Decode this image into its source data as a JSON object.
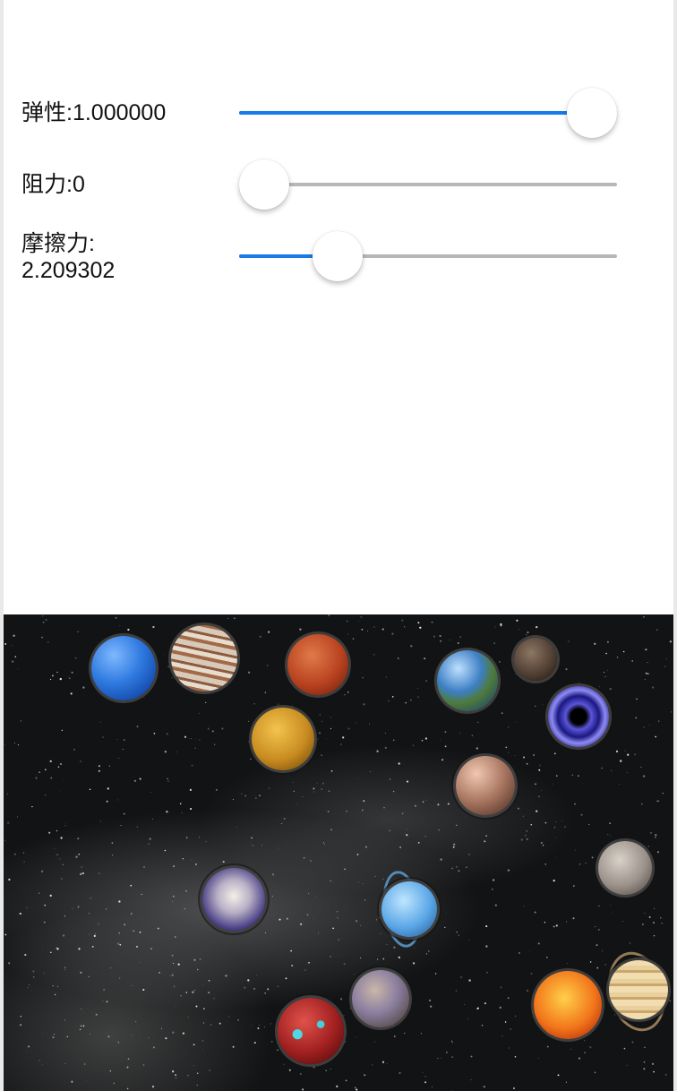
{
  "controls": [
    {
      "label": "弹性:1.000000",
      "value_fraction": 1.0
    },
    {
      "label": "阻力:0",
      "value_fraction": 0.0
    },
    {
      "label": "摩擦力:\n2.209302",
      "value_fraction": 0.26
    }
  ],
  "colors": {
    "slider_fill": "#1a7ae8",
    "slider_track": "#b7b7b7",
    "background": "#ffffff",
    "space": "#121314"
  },
  "planets": [
    {
      "name": "neptune-icon"
    },
    {
      "name": "jupiter-icon"
    },
    {
      "name": "mars-icon"
    },
    {
      "name": "venus-icon"
    },
    {
      "name": "earth-icon"
    },
    {
      "name": "small-moon-icon"
    },
    {
      "name": "black-hole-icon"
    },
    {
      "name": "rocky-planet-icon"
    },
    {
      "name": "moon-icon"
    },
    {
      "name": "nebula-planet-icon"
    },
    {
      "name": "uranus-icon"
    },
    {
      "name": "mercury-icon"
    },
    {
      "name": "lava-planet-icon"
    },
    {
      "name": "sun-icon"
    },
    {
      "name": "saturn-icon"
    }
  ]
}
